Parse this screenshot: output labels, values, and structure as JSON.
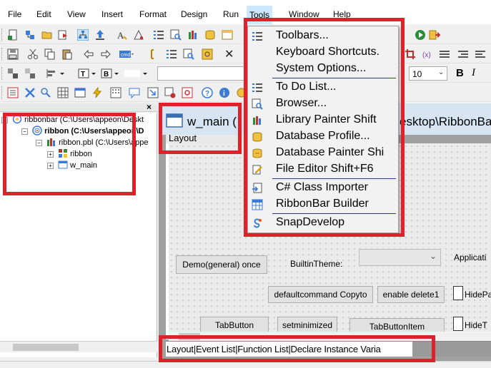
{
  "menubar": {
    "items": [
      "File",
      "Edit",
      "View",
      "Insert",
      "Format",
      "Design",
      "Run",
      "Tools",
      "Window",
      "Help"
    ],
    "active": "Tools"
  },
  "format_toolbar": {
    "font_size": "10",
    "bold": "B",
    "italic": "I"
  },
  "tree": {
    "workspace": "ribbonbar (C:\\Users\\appeon\\Deskt",
    "target": "ribbon (C:\\Users\\appeon\\D",
    "library": "ribbon.pbl (C:\\Users\\appe",
    "objects": [
      "ribbon",
      "w_main"
    ]
  },
  "painter": {
    "title": "w_main (",
    "title_path": "esktop\\RibbonBa",
    "layout_tab": "Layout",
    "buttons": {
      "demo": "Demo(general)  once",
      "defaultcommand": "defaultcommand Copyto",
      "enable_delete": "enable delete1",
      "tabbutton": "TabButton",
      "setminimized": "setminimized",
      "tabbuttonitem": "TabButtonItem"
    },
    "labels": {
      "builtin_theme": "BuiltinTheme:",
      "applicati": "Applicati",
      "hidepa": "HidePa",
      "hidet": "HideT"
    },
    "tabstrip": "Layout|Event List|Function List|Declare Instance Varia"
  },
  "tools_menu": {
    "items": [
      {
        "label": "Toolbars...",
        "icon": "toolbars-icon"
      },
      {
        "label": "Keyboard Shortcuts.",
        "icon": "none"
      },
      {
        "label": "System Options...",
        "icon": "none"
      },
      {
        "label": "To Do List...",
        "icon": "todo-list-icon"
      },
      {
        "label": "Browser...",
        "icon": "browser-icon"
      },
      {
        "label": "Library Painter  Shift",
        "icon": "library-painter-icon"
      },
      {
        "label": "Database Profile...",
        "icon": "database-profile-icon"
      },
      {
        "label": "Database Painter  Shi",
        "icon": "database-painter-icon"
      },
      {
        "label": "File Editor    Shift+F6",
        "icon": "file-editor-icon"
      },
      {
        "label": "C# Class Importer",
        "icon": "class-importer-icon"
      },
      {
        "label": "RibbonBar Builder",
        "icon": "ribbonbar-builder-icon"
      },
      {
        "label": "SnapDevelop",
        "icon": "snapdevelop-icon"
      }
    ]
  },
  "colors": {
    "highlight_box": "#e0202a",
    "menu_separator": "#2b3d8a",
    "active_menu": "#cce8ff"
  }
}
